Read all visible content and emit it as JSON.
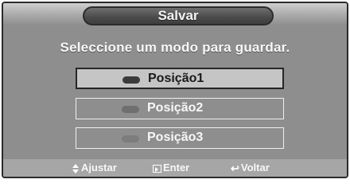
{
  "dialog": {
    "title": "Salvar",
    "prompt": "Seleccione um modo para guardar."
  },
  "options": [
    {
      "label": "Posição1",
      "selected": true
    },
    {
      "label": "Posição2",
      "selected": false
    },
    {
      "label": "Posição3",
      "selected": false
    }
  ],
  "hints": {
    "adjust": "Ajustar",
    "enter": "Enter",
    "back": "Voltar"
  },
  "icons": {
    "adjust": "up-down-arrows-icon",
    "enter": "enter-icon",
    "back": "return-arrow-icon"
  },
  "colors": {
    "panel": "#8e8e8e",
    "selected_fill": "#c5c5c5",
    "bottom_bar": "#a6a6a6"
  }
}
